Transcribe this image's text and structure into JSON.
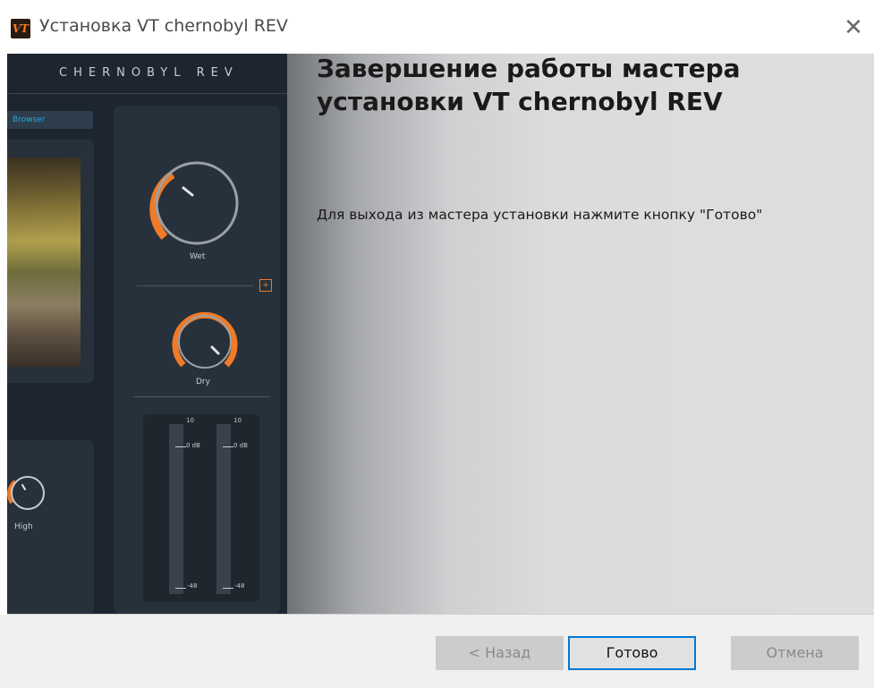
{
  "window": {
    "title": "Установка VT chernobyl REV",
    "icon_text": "VT",
    "close_symbol": "✕"
  },
  "banner": {
    "plugin_name": "CHERNOBYL REV",
    "browser_tab": "Browser",
    "knob_wet_label": "Wet",
    "knob_dry_label": "Dry",
    "knob_high_label": "High",
    "plus_symbol": "+",
    "meter": {
      "left_top": "10",
      "right_top": "10",
      "left_mid": "0 dB",
      "right_mid": "0 dB",
      "left_bottom": "-48",
      "right_bottom": "-48"
    },
    "accent_color": "#f07a26"
  },
  "content": {
    "heading": "Завершение работы мастера установки VT chernobyl REV",
    "body": "Для выхода из мастера установки нажмите кнопку \"Готово\""
  },
  "buttons": {
    "back": "< Назад",
    "finish": "Готово",
    "cancel": "Отмена"
  },
  "colors": {
    "focus_border": "#0078d7",
    "banner_bg": "#1d2630"
  }
}
